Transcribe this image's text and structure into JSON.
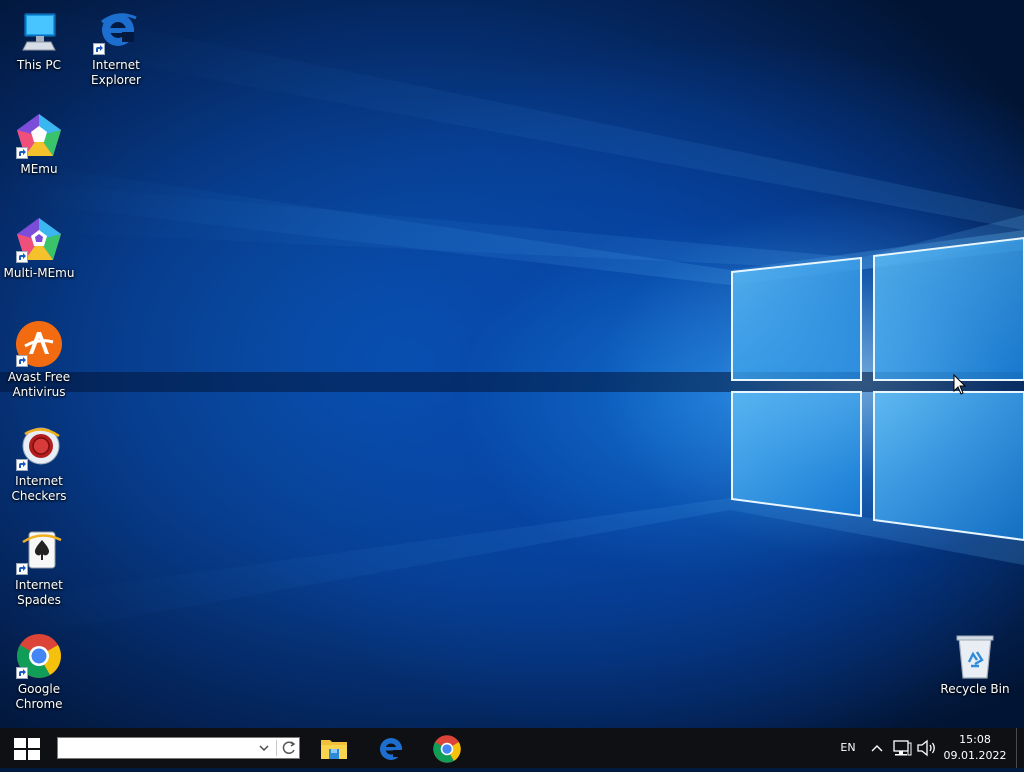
{
  "desktop": {
    "icons": [
      {
        "label": "This PC",
        "icon": "this-pc-icon"
      },
      {
        "label": "Internet\nExplorer",
        "icon": "internet-explorer-icon"
      },
      {
        "label": "MEmu",
        "icon": "memu-icon"
      },
      {
        "label": "Multi-MEmu",
        "icon": "multi-memu-icon"
      },
      {
        "label": "Avast Free\nAntivirus",
        "icon": "avast-icon"
      },
      {
        "label": "Internet\nCheckers",
        "icon": "internet-checkers-icon"
      },
      {
        "label": "Internet\nSpades",
        "icon": "internet-spades-icon"
      },
      {
        "label": "Google\nChrome",
        "icon": "chrome-icon"
      },
      {
        "label": "Recycle Bin",
        "icon": "recycle-bin-icon"
      }
    ]
  },
  "taskbar": {
    "address_value": "",
    "pinned_apps": [
      "file-explorer-icon",
      "edge-icon",
      "chrome-icon"
    ],
    "tray": {
      "language": "EN",
      "time": "15:08",
      "date": "09.01.2022"
    }
  },
  "colors": {
    "taskbar": "#0f1014",
    "accent": "#1e7fd8",
    "wallpaper_dark": "#021433",
    "wallpaper_light": "#aee0ff"
  }
}
